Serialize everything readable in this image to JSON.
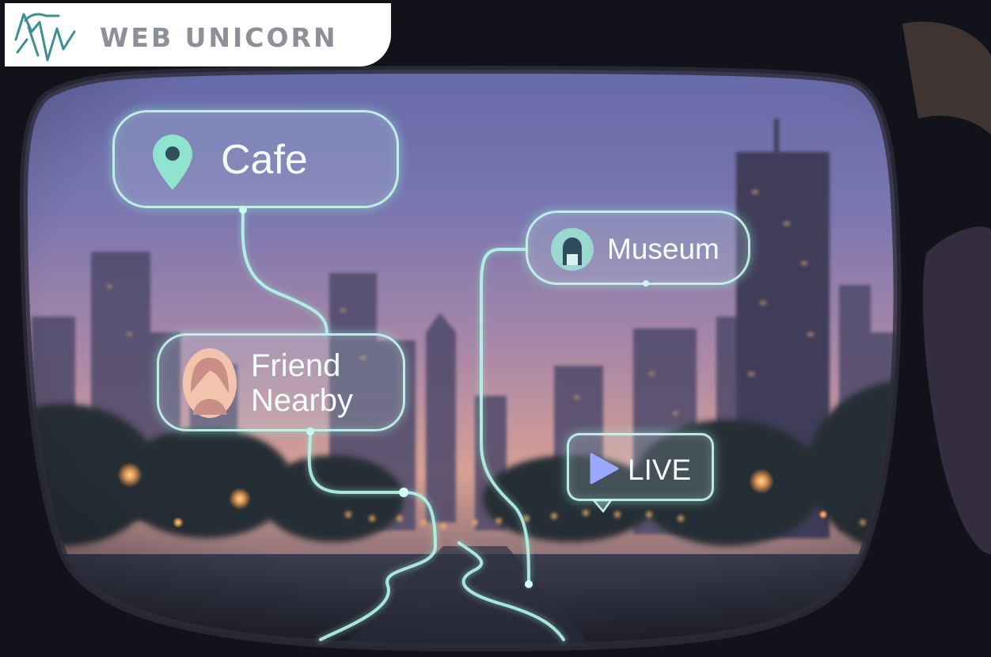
{
  "logo": {
    "text": "WEB UNICORN",
    "icon": "unicorn-logo-icon"
  },
  "overlays": {
    "cafe": {
      "label": "Cafe",
      "icon": "map-pin-icon"
    },
    "museum": {
      "label": "Museum",
      "icon": "museum-arch-icon"
    },
    "friend": {
      "line1": "Friend",
      "line2": "Nearby",
      "icon": "friend-avatar-icon"
    },
    "live": {
      "label": "LIVE",
      "icon": "play-icon"
    }
  },
  "colors": {
    "hud_glow": "#c4f6ec",
    "pin_teal": "#8fe3cf",
    "museum_teal": "#9ad8d0",
    "avatar_peach": "#f3c4ad",
    "play_blue": "#9aa8ff",
    "logo_gray": "#8c9099"
  }
}
